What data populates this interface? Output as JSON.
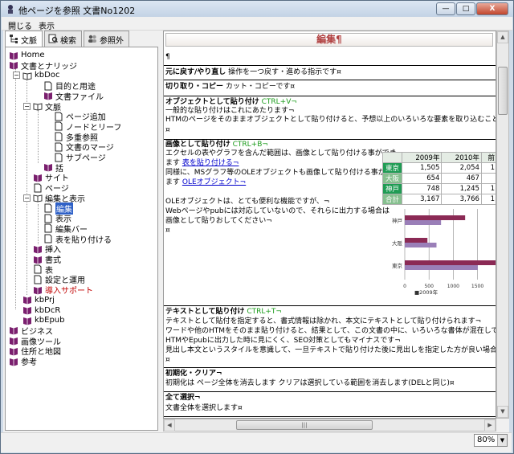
{
  "window": {
    "title": "他ページを参照 文書No1202",
    "buttons": [
      "—",
      "□",
      "X"
    ]
  },
  "menu": [
    "開じる",
    "表示"
  ],
  "tabs": [
    {
      "label": "文脈",
      "icon": "tree-icon"
    },
    {
      "label": "検索",
      "icon": "search-icon"
    },
    {
      "label": "参照外",
      "icon": "people-icon"
    }
  ],
  "tree": [
    "Home",
    "文書とナリッジ",
    "kbDoc",
    "目的と用途",
    "文書ファイル",
    "文脈",
    "ページ追加",
    "ノードとリーフ",
    "多重参照",
    "文書のマージ",
    "サブページ",
    "括",
    "サイト",
    "ページ",
    "編集と表示",
    "編集",
    "表示",
    "編集バー",
    "表を貼り付ける",
    "挿入",
    "書式",
    "表",
    "設定と運用",
    "導入サポート",
    "kbPrj",
    "kbDcR",
    "kbEpub",
    "ビジネス",
    "画像ツール",
    "住所と地図",
    "参考"
  ],
  "doc": {
    "heading": "編集¶",
    "para_mark": "¶",
    "sections": [
      {
        "title": "元に戻す/やり直し",
        "rest": "操作を一つ戻す・進める指示です¤"
      },
      {
        "title": "切り取り・コピー",
        "rest": "カット・コピーです¤"
      },
      {
        "title": "オブジェクトとして貼り付け",
        "shortcut": "CTRL+V¬",
        "lines": [
          "一般的な貼り付けはこれにあたります¬",
          "HTMのページをそのままオブジェクトとして貼り付けると、予想以上のいろいろな要素を取り込むことになるので注意",
          "¤"
        ]
      },
      {
        "title": "画像として貼り付け",
        "shortcut": "CTRL+B¬",
        "lines": [
          "エクセルの表やグラフを含んだ範囲は、画像として貼り付ける事ができ",
          "ます",
          "表を貼り付ける¬",
          "同様に、MSグラフ等のOLEオブジェクトも画像して貼り付ける事ができ",
          "ます",
          "OLEオブジェクト¬",
          "OLEオブジェクトは、とても便利な機能ですが、¬",
          "Webページやpubには対応していないので、それらに出力する場合は",
          "画像として貼りおしてください¬",
          "¤"
        ]
      },
      {
        "title": "テキストとして貼り付け",
        "shortcut": "CTRL+T¬",
        "lines": [
          "テキストとして貼付を指定すると、書式情報は除かれ、本文にテキストとして貼り付けられます¬",
          "ワードや他のHTMをそのまま貼り付けると、結果として、この文書の中に、いろいろな書体が混在してしまいます¬",
          "HTMやEpubに出力した時に見にくく、SEO対策としてもマイナスです¬",
          "見出し本文というスタイルを意識して、一旦テキストで貼り付けた後に見出しを指定した方が良い場合があります¬",
          "¤"
        ]
      },
      {
        "title": "初期化・クリア¬",
        "lines": [
          "初期化は ページ全体を消去します  クリアは選択している範囲を消去します(DELと同じ)¤"
        ]
      },
      {
        "title": "全て選択¬",
        "lines": [
          "文書全体を選択します¤"
        ]
      }
    ],
    "table": {
      "headers": [
        "",
        "2009年",
        "2010年",
        "前"
      ],
      "rows": [
        [
          "東京",
          "1,505",
          "2,054",
          "1"
        ],
        [
          "大阪",
          "654",
          "467",
          ""
        ],
        [
          "神戸",
          "748",
          "1,245",
          "1"
        ],
        [
          "合計",
          "3,167",
          "3,766",
          "1"
        ]
      ]
    }
  },
  "chart_data": {
    "type": "bar",
    "orientation": "horizontal",
    "categories": [
      "神戸",
      "大阪",
      "東京"
    ],
    "series": [
      {
        "name": "",
        "values": [
          1245,
          467,
          2054
        ],
        "color": "#8b2a55"
      },
      {
        "name": "",
        "values": [
          748,
          654,
          1505
        ],
        "color": "#9a7fb8"
      }
    ],
    "xticks": [
      "0",
      "500",
      "1000",
      "1500"
    ],
    "legend": "■2009年",
    "xlim": [
      0,
      2000
    ]
  },
  "zoom": "80%",
  "colors": {
    "selection": "#2f61c7",
    "heading": "#b04040",
    "shortcut": "#1c9c1c",
    "link": "#0000cc"
  }
}
